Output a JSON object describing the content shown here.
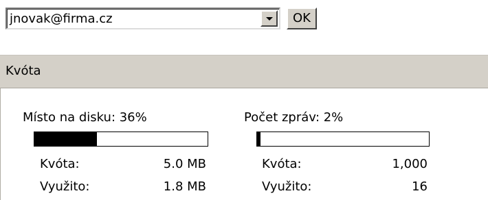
{
  "account": {
    "selected": "jnovak@firma.cz",
    "ok_label": "OK"
  },
  "quota": {
    "title": "Kvóta",
    "disk": {
      "heading": "Místo na disku: 36%",
      "percent": 36,
      "quota_label": "Kvóta:",
      "quota_value": "5.0 MB",
      "used_label": "Využito:",
      "used_value": "1.8 MB"
    },
    "messages": {
      "heading": "Počet zpráv: 2%",
      "percent": 2,
      "quota_label": "Kvóta:",
      "quota_value": "1,000",
      "used_label": "Využito:",
      "used_value": "16"
    }
  }
}
